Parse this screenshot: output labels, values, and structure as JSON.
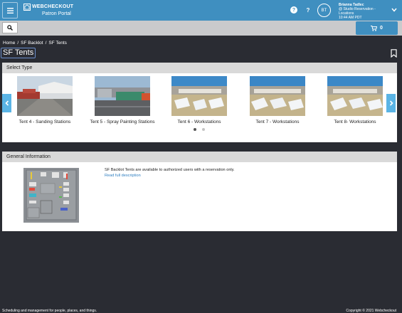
{
  "header": {
    "brand_name": "WEBCHECKOUT",
    "brand_sub": "Patron Portal",
    "help_badge": "?",
    "question": "?",
    "avatar_initials": "BT",
    "user_name": "Brianna Tadlec",
    "user_location": "@ Studio Reservation - Locations",
    "user_time": "10:44 AM PDT"
  },
  "toolbar": {
    "cart_count": "0"
  },
  "breadcrumb": {
    "items": [
      "Home",
      "SF Backlot",
      "SF Tents"
    ],
    "separator": "/"
  },
  "page": {
    "title": "SF Tents"
  },
  "select_type": {
    "heading": "Select Type",
    "slides": [
      {
        "label": "Tent 4 - Sanding Stations"
      },
      {
        "label": "Tent 5 - Spray Painting Stations"
      },
      {
        "label": "Tent 6 - Workstations"
      },
      {
        "label": "Tent 7 - Workstations"
      },
      {
        "label": "Tent 8- Workstations"
      }
    ],
    "active_page": 1,
    "page_count": 2
  },
  "general_info": {
    "heading": "General Information",
    "description": "SF Backlot Tents are available to authorized users with a reservation only.",
    "link": "Read full description"
  },
  "footer": {
    "left": "Scheduling and management for people, places, and things.",
    "right": "Copyright © 2021 Webcheckout"
  },
  "colors": {
    "header": "#3f8fc0",
    "accent_arrow": "#5ab4e5",
    "background": "#2a2c33"
  }
}
